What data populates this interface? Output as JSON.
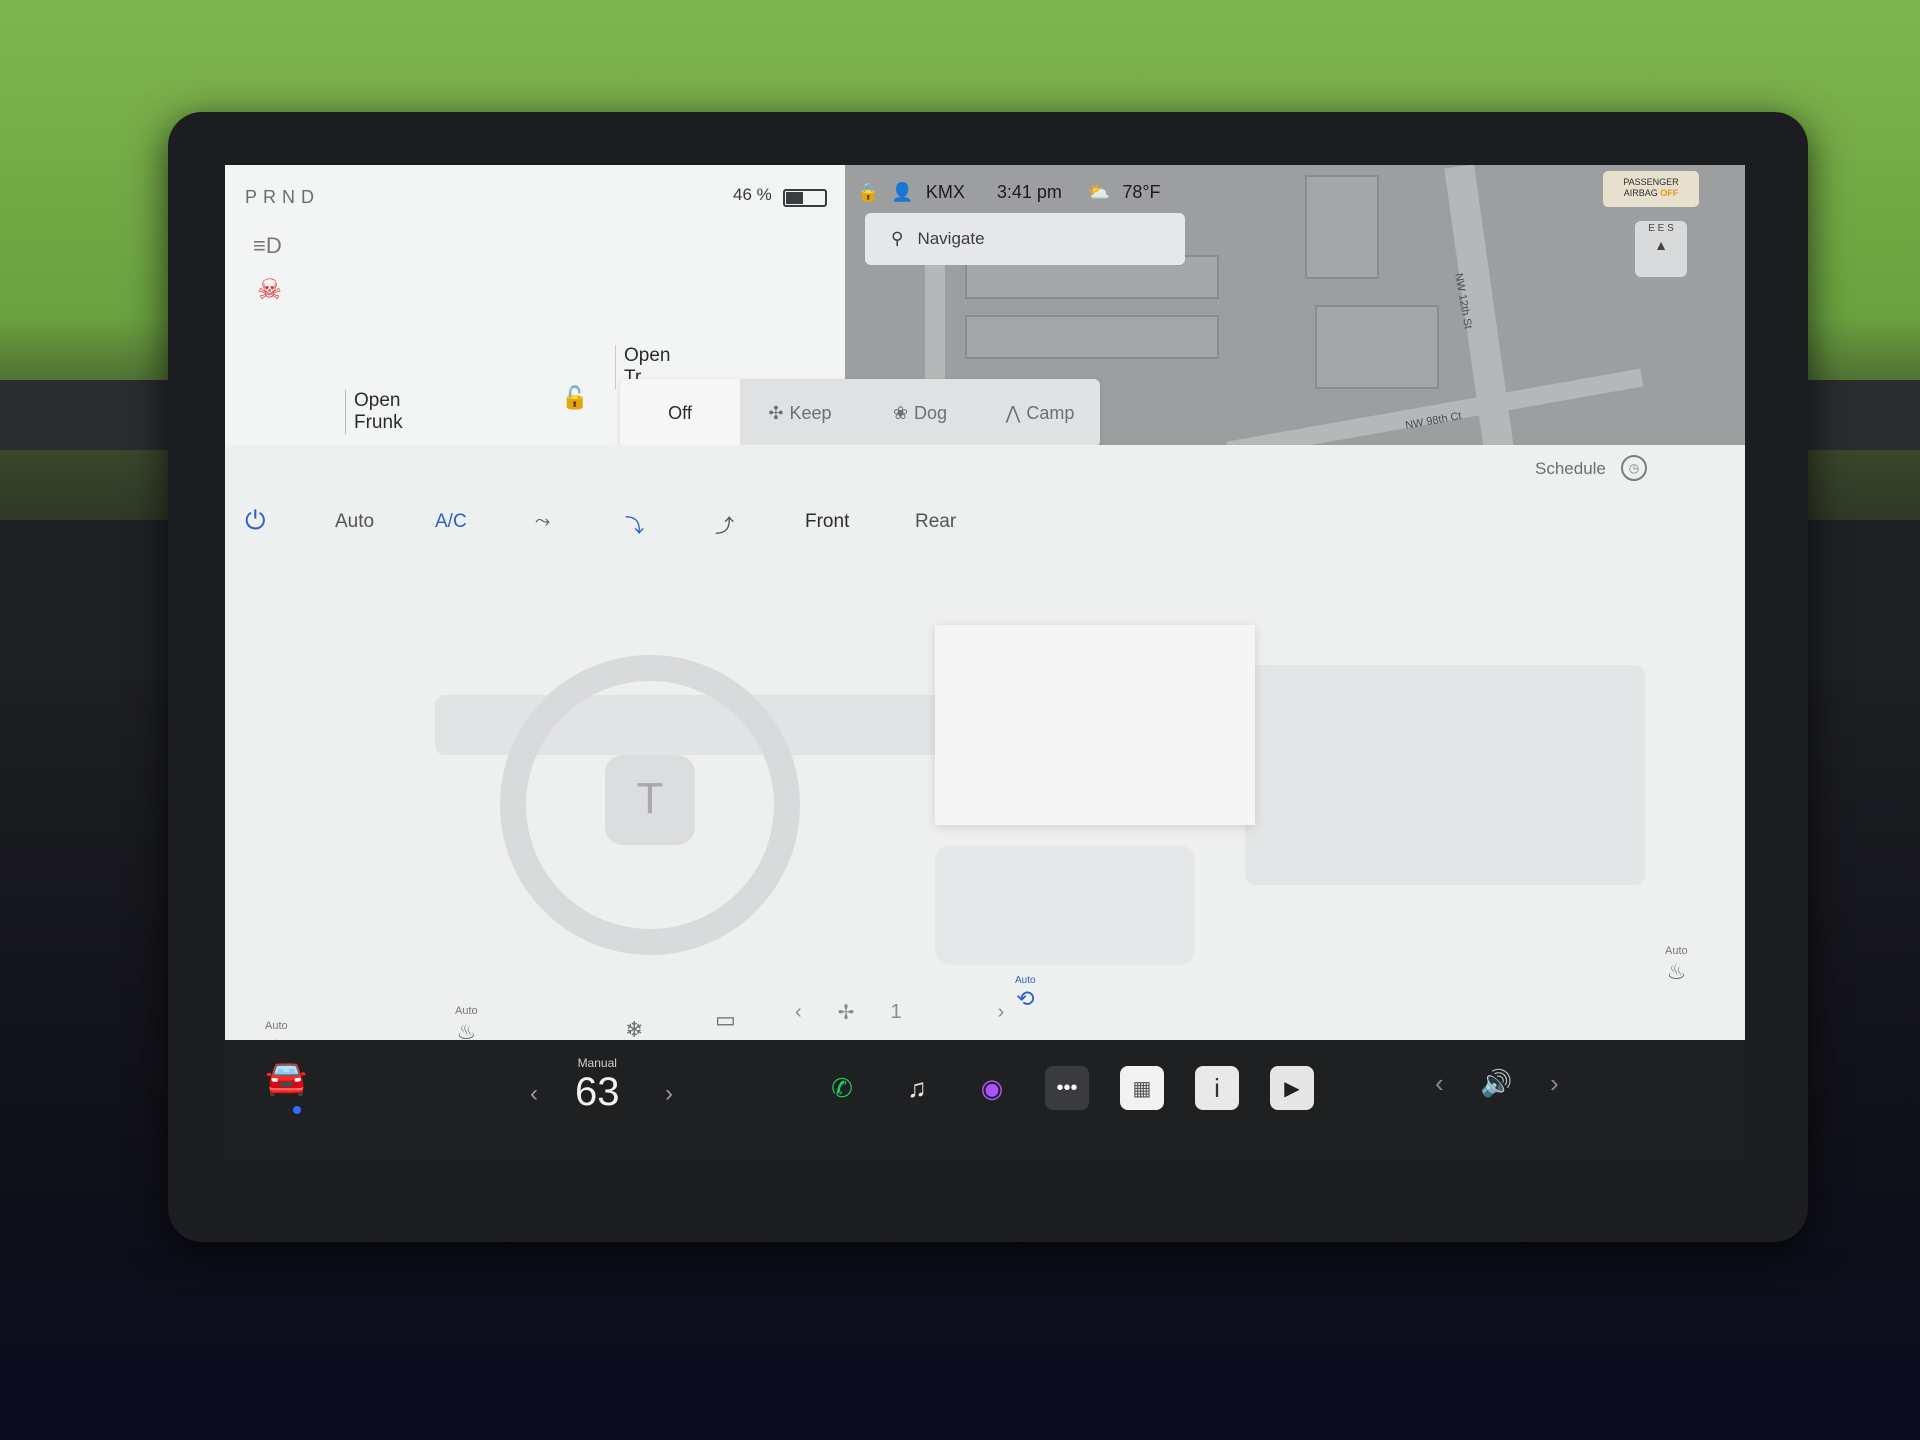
{
  "status": {
    "gear": "PRND",
    "battery_percent": "46 %",
    "battery_level": 0.46,
    "driver": "KMX",
    "time": "3:41 pm",
    "temperature": "78°F",
    "weather_icon": "partly-cloudy-icon"
  },
  "navigation": {
    "search_placeholder": "Navigate",
    "streets": [
      "NW 12th St",
      "NW 98th Ct"
    ],
    "compass": "E E S"
  },
  "airbag": {
    "line1": "PASSENGER",
    "line2": "AIRBAG",
    "state": "OFF"
  },
  "car_controls": {
    "frunk_line1": "Open",
    "frunk_line2": "Frunk",
    "trunk_line1": "Open",
    "trunk_line2": "Tr"
  },
  "climate_modes": [
    {
      "label": "Off",
      "icon": ""
    },
    {
      "label": "Keep",
      "icon": "fan-icon"
    },
    {
      "label": "Dog",
      "icon": "paw-icon"
    },
    {
      "label": "Camp",
      "icon": "tent-icon"
    }
  ],
  "climate": {
    "auto": "Auto",
    "ac": "A/C",
    "front": "Front",
    "rear": "Rear",
    "schedule": "Schedule",
    "seat_auto_label": "Auto",
    "fan_speed": "1",
    "recirc_label": "Auto"
  },
  "dock": {
    "temp_mode": "Manual",
    "temp_value": "63",
    "apps": [
      "phone-icon",
      "music-icon",
      "camera-icon",
      "more-icon",
      "calendar-icon",
      "manual-icon",
      "media-icon"
    ]
  },
  "colors": {
    "accent_blue": "#2a63c8",
    "alert_red": "#e0302a",
    "phone_green": "#22c55e"
  }
}
